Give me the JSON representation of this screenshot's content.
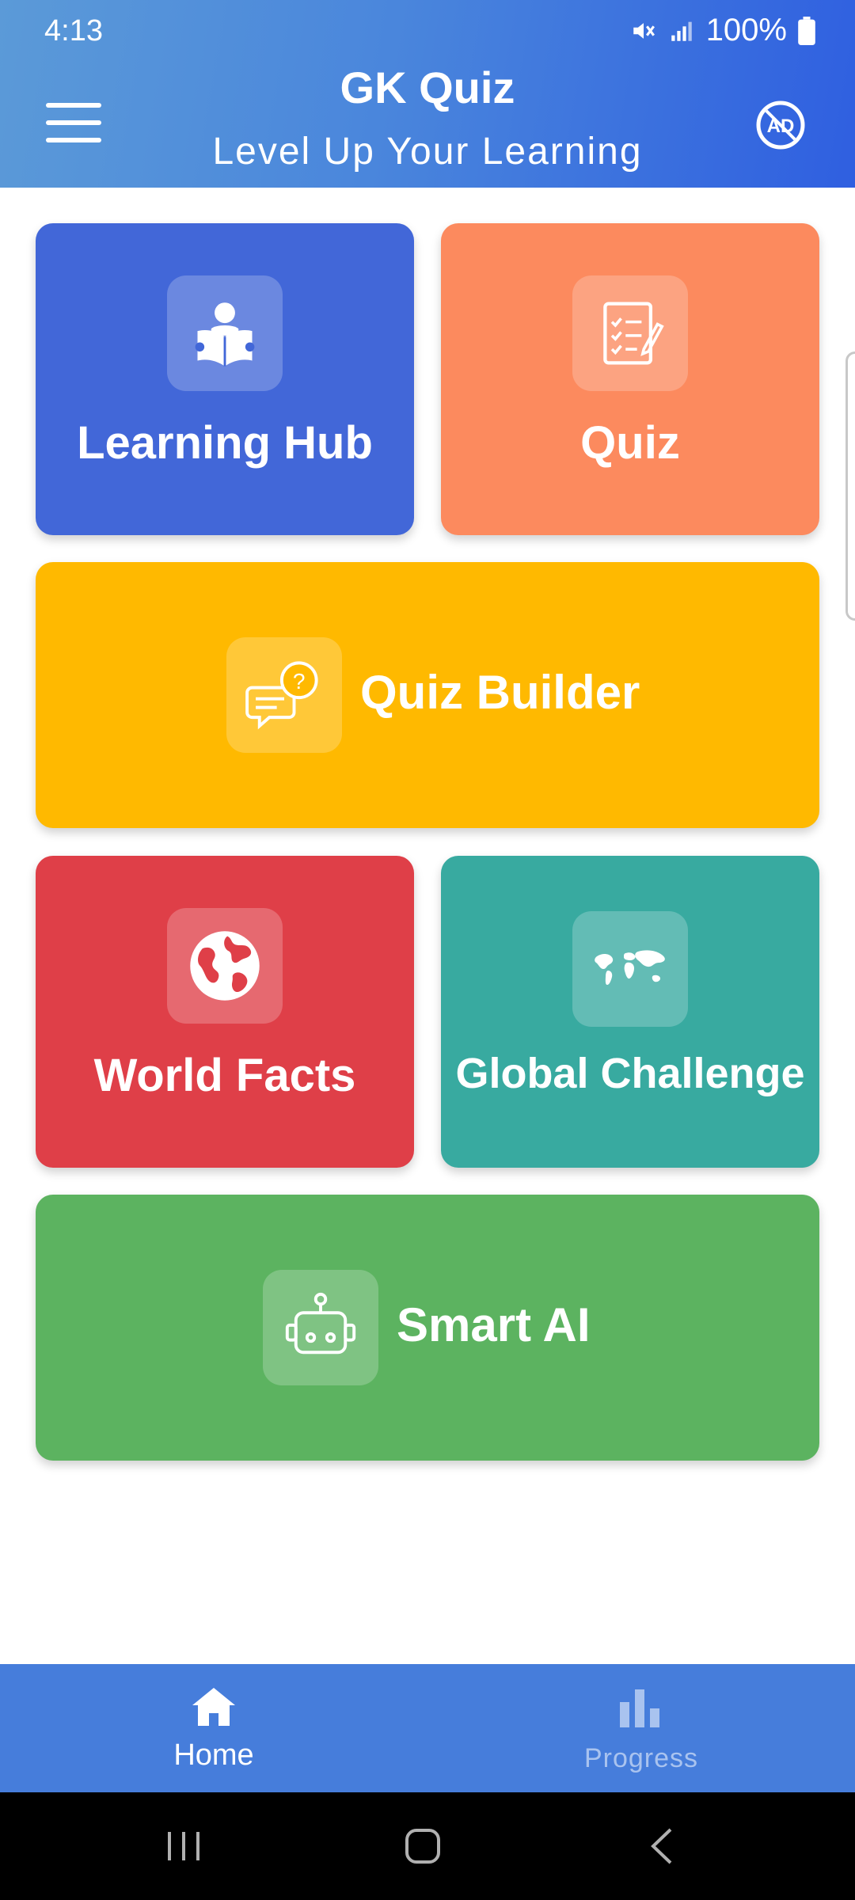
{
  "status_bar": {
    "time": "4:13",
    "battery": "100%"
  },
  "header": {
    "title": "GK Quiz",
    "subtitle": "Level Up Your Learning"
  },
  "tiles": [
    {
      "label": "Learning Hub",
      "color": "#4267d8",
      "icon": "reading-person-icon"
    },
    {
      "label": "Quiz",
      "color": "#fc8a5e",
      "icon": "checklist-document-icon"
    },
    {
      "label": "Quiz Builder",
      "color": "#ffb900",
      "icon": "question-chat-icon"
    },
    {
      "label": "World Facts",
      "color": "#df3f48",
      "icon": "globe-icon"
    },
    {
      "label": "Global Challenge",
      "color": "#38aaa0",
      "icon": "world-map-icon"
    },
    {
      "label": "Smart AI",
      "color": "#5cb360",
      "icon": "robot-icon"
    }
  ],
  "bottom_nav": {
    "items": [
      {
        "label": "Home",
        "icon": "home-icon",
        "active": true
      },
      {
        "label": "Progress",
        "icon": "bar-chart-icon",
        "active": false
      }
    ]
  },
  "colors": {
    "header_start": "#5b9ad8",
    "header_end": "#2f5fe0",
    "nav_bg": "#467ddb"
  }
}
